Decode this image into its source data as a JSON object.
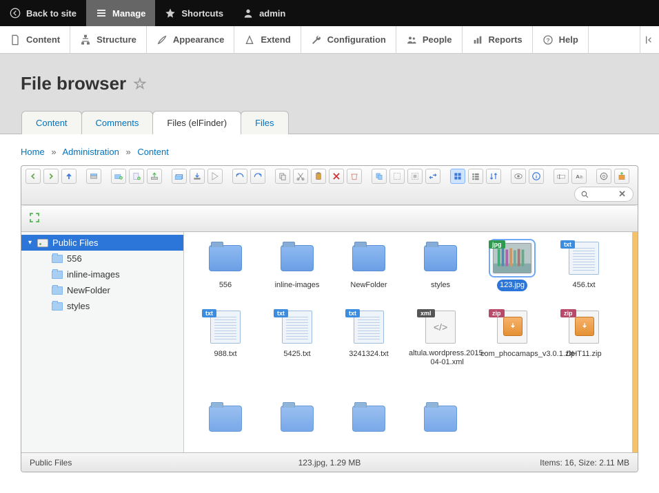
{
  "topbar": {
    "back": "Back to site",
    "manage": "Manage",
    "shortcuts": "Shortcuts",
    "user": "admin"
  },
  "adminmenu": {
    "content": "Content",
    "structure": "Structure",
    "appearance": "Appearance",
    "extend": "Extend",
    "configuration": "Configuration",
    "people": "People",
    "reports": "Reports",
    "help": "Help"
  },
  "page": {
    "title": "File browser"
  },
  "tabs": {
    "content": "Content",
    "comments": "Comments",
    "files_elf": "Files (elFinder)",
    "files": "Files"
  },
  "breadcrumb": {
    "home": "Home",
    "admin": "Administration",
    "content": "Content"
  },
  "tree": {
    "root": "Public Files",
    "nodes": {
      "n0": "556",
      "n1": "inline-images",
      "n2": "NewFolder",
      "n3": "styles"
    }
  },
  "files": {
    "f0": {
      "name": "556",
      "type": "folder"
    },
    "f1": {
      "name": "inline-images",
      "type": "folder"
    },
    "f2": {
      "name": "NewFolder",
      "type": "folder"
    },
    "f3": {
      "name": "styles",
      "type": "folder"
    },
    "f4": {
      "name": "123.jpg",
      "type": "jpg",
      "selected": true
    },
    "f5": {
      "name": "456.txt",
      "type": "txt"
    },
    "f6": {
      "name": "988.txt",
      "type": "txt"
    },
    "f7": {
      "name": "5425.txt",
      "type": "txt"
    },
    "f8": {
      "name": "3241324.txt",
      "type": "txt"
    },
    "f9": {
      "name": "altula.wordpress.2015-04-01.xml",
      "type": "xml"
    },
    "f10": {
      "name": "com_phocamaps_v3.0.1.zip",
      "type": "zip"
    },
    "f11": {
      "name": "DHT11.zip",
      "type": "zip"
    }
  },
  "status": {
    "path": "Public Files",
    "selection": "123.jpg, 1.29 MB",
    "summary": "Items: 16, Size: 2.11 MB"
  },
  "toolbar_icons": [
    "back",
    "forward",
    "up",
    "netmount",
    "newfolder",
    "newfile",
    "upload",
    "open",
    "download",
    "getfile",
    "undo",
    "redo",
    "copy",
    "cut",
    "paste",
    "rm",
    "empty",
    "duplicate",
    "selectall",
    "selectnone",
    "selectinvert",
    "view-icons",
    "view-list",
    "sort",
    "preview",
    "info",
    "rename",
    "edit",
    "resize",
    "mkdir",
    "search"
  ]
}
